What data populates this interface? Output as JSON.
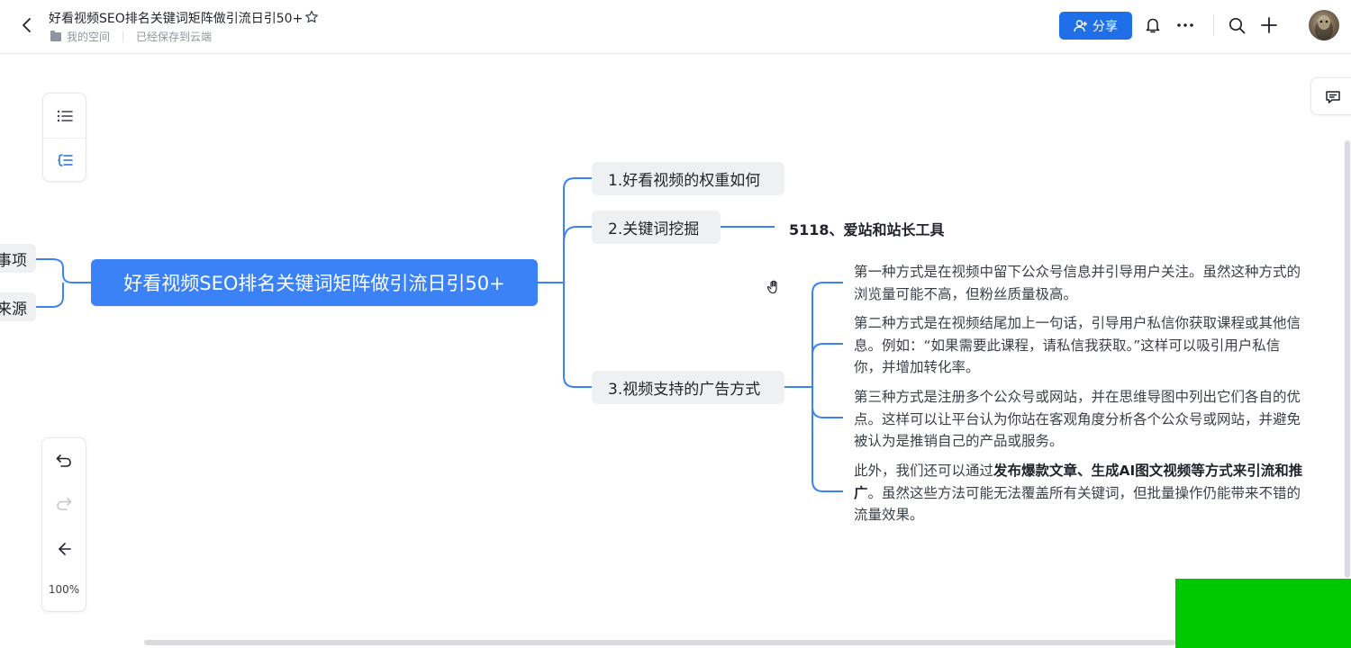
{
  "header": {
    "title": "好看视频SEO排名关键词矩阵做引流日引50+",
    "location": "我的空间",
    "save_status": "已经保存到云端",
    "share_label": "分享"
  },
  "toolbar": {
    "zoom": "100%"
  },
  "mindmap": {
    "root": "好看视频SEO排名关键词矩阵做引流日引50+",
    "left_nodes": [
      "事项",
      "来源"
    ],
    "branches": [
      {
        "label": "1.好看视频的权重如何"
      },
      {
        "label": "2.关键词挖掘",
        "leaf": "5118、爱站和站长工具"
      },
      {
        "label": "3.视频支持的广告方式",
        "leaves": [
          "第一种方式是在视频中留下公众号信息并引导用户关注。虽然这种方式的浏览量可能不高，但粉丝质量极高。",
          "第二种方式是在视频结尾加上一句话，引导用户私信你获取课程或其他信息。例如：“如果需要此课程，请私信我获取。”这样可以吸引用户私信你，并增加转化率。",
          "第三种方式是注册多个公众号或网站，并在思维导图中列出它们各自的优点。这样可以让平台认为你站在客观角度分析各个公众号或网站，并避免被认为是推销自己的产品或服务。"
        ],
        "last_leaf": {
          "prefix": "此外，我们还可以通过",
          "bold": "发布爆款文章、生成AI图文视频等方式来引流和推广",
          "suffix": "。虽然这些方法可能无法覆盖所有关键词，但批量操作仍能带来不错的流量效果。"
        }
      }
    ]
  },
  "colors": {
    "accent": "#1e6fe8",
    "root_fill": "#3b82f6",
    "edge": "#3b82f6",
    "node_fill": "#eff0f1",
    "overlay_green": "#00c800"
  },
  "icons": [
    "back-icon",
    "star-icon",
    "folder-icon",
    "user-add-icon",
    "bell-icon",
    "more-icon",
    "search-icon",
    "plus-icon",
    "outline-list-icon",
    "structure-icon",
    "undo-icon",
    "redo-icon",
    "layout-icon",
    "comment-icon",
    "hand-cursor-icon"
  ]
}
